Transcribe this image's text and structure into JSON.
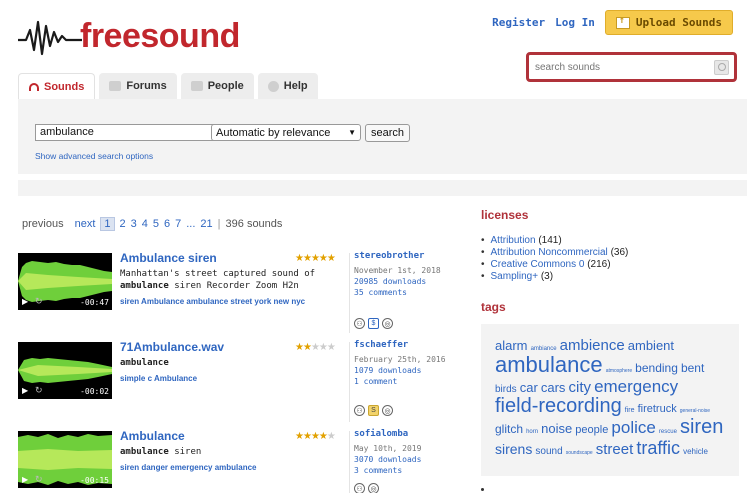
{
  "brand": {
    "name": "freesound",
    "accent": "#c1272d",
    "link": "#2f66c0"
  },
  "top_links": {
    "register": "Register",
    "login": "Log In",
    "upload": "Upload Sounds"
  },
  "search_top": {
    "placeholder": "search sounds"
  },
  "tabs": [
    {
      "label": "Sounds",
      "icon": "headphones-icon",
      "active": true
    },
    {
      "label": "Forums",
      "icon": "chat-icon",
      "active": false
    },
    {
      "label": "People",
      "icon": "people-icon",
      "active": false
    },
    {
      "label": "Help",
      "icon": "help-icon",
      "active": false
    }
  ],
  "search_panel": {
    "query": "ambulance",
    "sort": "Automatic by relevance",
    "search_button": "search",
    "advanced_link": "Show advanced search options"
  },
  "pager": {
    "previous": "previous",
    "next": "next",
    "current": "1",
    "pages": [
      "2",
      "3",
      "4",
      "5",
      "6",
      "7",
      "...",
      "21"
    ],
    "separator": "|",
    "count": "396 sounds"
  },
  "results": [
    {
      "title": "Ambulance siren",
      "desc_pre": "Manhattan's street captured sound of",
      "desc_bold": "ambulance",
      "desc_post": "siren Recorder Zoom H2n",
      "tags": "siren Ambulance ambulance street york new nyc",
      "rating": 5,
      "user": "stereobrother",
      "date": "November 1st, 2018",
      "downloads": "20985 downloads",
      "comments": "35 comments",
      "duration": "-00:47",
      "license_icons": [
        "attribution-icon",
        "noncommercial-icon",
        "cc-icon"
      ]
    },
    {
      "title": "71Ambulance.wav",
      "desc_pre": "",
      "desc_bold": "ambulance",
      "desc_post": "",
      "tags": "simple c Ambulance",
      "rating": 2,
      "user": "fschaeffer",
      "date": "February 25th, 2016",
      "downloads": "1079 downloads",
      "comments": "1 comment",
      "duration": "-00:02",
      "license_icons": [
        "attribution-icon",
        "sampling-icon",
        "cc-icon"
      ]
    },
    {
      "title": "Ambulance",
      "desc_pre": "",
      "desc_bold": "ambulance",
      "desc_post": "siren",
      "tags": "siren danger emergency ambulance",
      "rating": 4,
      "user": "sofialomba",
      "date": "May 10th, 2019",
      "downloads": "3070 downloads",
      "comments": "3 comments",
      "duration": "-00:15",
      "license_icons": [
        "attribution-icon",
        "cc-icon"
      ]
    }
  ],
  "licenses": {
    "heading": "licenses",
    "items": [
      {
        "name": "Attribution",
        "count": "(141)"
      },
      {
        "name": "Attribution Noncommercial",
        "count": "(36)"
      },
      {
        "name": "Creative Commons 0",
        "count": "(216)"
      },
      {
        "name": "Sampling+",
        "count": "(3)"
      }
    ]
  },
  "tags": {
    "heading": "tags",
    "cloud": [
      {
        "t": "alarm",
        "s": 13
      },
      {
        "t": "ambiance",
        "s": 6
      },
      {
        "t": "ambience",
        "s": 15
      },
      {
        "t": "ambient",
        "s": 13
      },
      {
        "t": "ambulance",
        "s": 22
      },
      {
        "t": "atmosphere",
        "s": 5
      },
      {
        "t": "bending",
        "s": 12
      },
      {
        "t": "bent",
        "s": 12
      },
      {
        "t": "birds",
        "s": 10
      },
      {
        "t": "car",
        "s": 13
      },
      {
        "t": "cars",
        "s": 13
      },
      {
        "t": "city",
        "s": 15
      },
      {
        "t": "emergency",
        "s": 17
      },
      {
        "t": "field-recording",
        "s": 20
      },
      {
        "t": "fire",
        "s": 7
      },
      {
        "t": "firetruck",
        "s": 11
      },
      {
        "t": "general-noise",
        "s": 5
      },
      {
        "t": "glitch",
        "s": 12
      },
      {
        "t": "horn",
        "s": 6
      },
      {
        "t": "noise",
        "s": 13
      },
      {
        "t": "people",
        "s": 11
      },
      {
        "t": "police",
        "s": 17
      },
      {
        "t": "rescue",
        "s": 6
      },
      {
        "t": "siren",
        "s": 20
      },
      {
        "t": "sirens",
        "s": 14
      },
      {
        "t": "sound",
        "s": 10
      },
      {
        "t": "soundscape",
        "s": 5
      },
      {
        "t": "street",
        "s": 15
      },
      {
        "t": "traffic",
        "s": 18
      },
      {
        "t": "vehicle",
        "s": 8
      }
    ]
  }
}
